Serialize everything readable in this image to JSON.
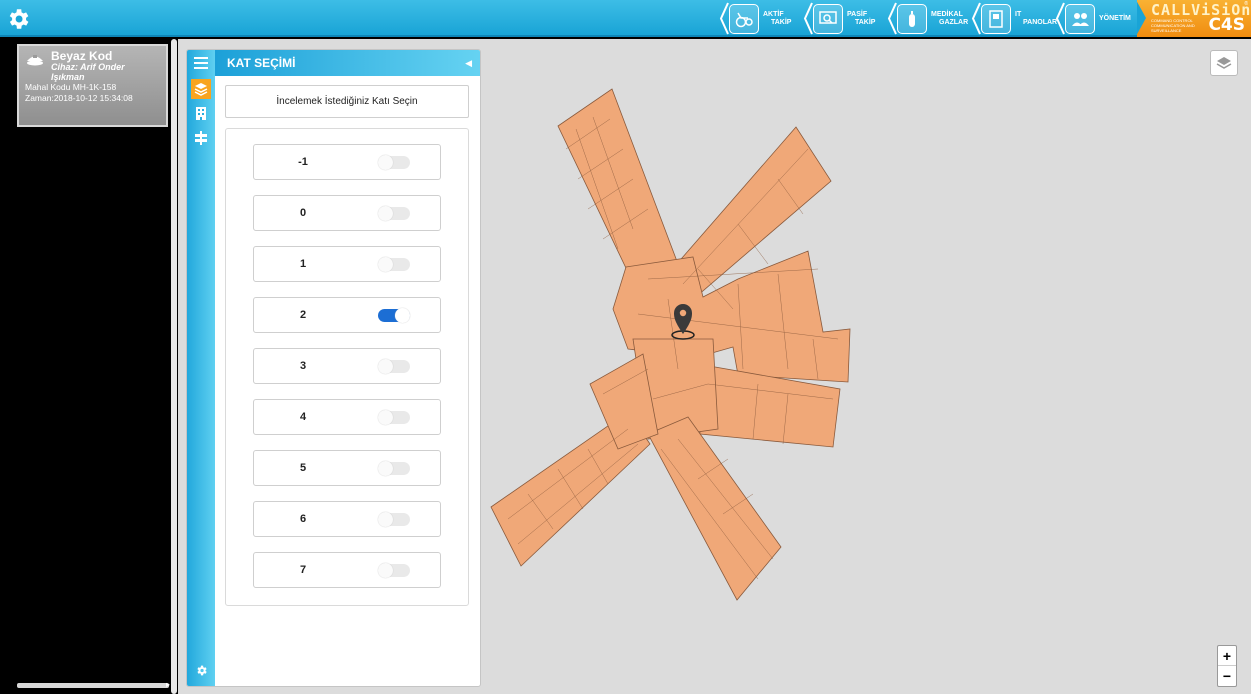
{
  "topbar": {
    "nav": [
      {
        "line1": "AKTİF",
        "line2": "TAKİP",
        "icon": "wheelchair-icon"
      },
      {
        "line1": "PASİF",
        "line2": "TAKİP",
        "icon": "monitor-search-icon"
      },
      {
        "line1": "MEDİKAL",
        "line2": "GAZLAR",
        "icon": "gas-cylinder-icon"
      },
      {
        "line1": "IT",
        "line2": "PANOLAR",
        "icon": "panel-icon"
      },
      {
        "line1": "YÖNETİM",
        "line2": "",
        "icon": "users-icon"
      }
    ],
    "brand": {
      "top": "CALLViSiOn",
      "small": "COMMAND CONTROL COMMUNICATION AND SURVEILLANCE",
      "c4s": "C4S",
      "reg": "®"
    }
  },
  "alert": {
    "title": "Beyaz Kod",
    "device": "Cihaz: Arif Onder Işıkman",
    "location": "Mahal Kodu MH-1K-158",
    "time": "Zaman:2018-10-12 15:34:08"
  },
  "floor_panel": {
    "title": "KAT SEÇİMİ",
    "select_label": "İncelemek İstediğiniz Katı Seçin",
    "floors": [
      {
        "label": "-1",
        "on": false
      },
      {
        "label": "0",
        "on": false
      },
      {
        "label": "1",
        "on": false
      },
      {
        "label": "2",
        "on": true
      },
      {
        "label": "3",
        "on": false
      },
      {
        "label": "4",
        "on": false
      },
      {
        "label": "5",
        "on": false
      },
      {
        "label": "6",
        "on": false
      },
      {
        "label": "7",
        "on": false
      }
    ]
  },
  "map": {
    "zoom_in": "+",
    "zoom_out": "−",
    "building_color": "#f0a878",
    "building_stroke": "#8a5a3c"
  },
  "colors": {
    "accent": "#19a4d6",
    "brand": "#f49d1e",
    "toggle_on": "#1c6ed4"
  }
}
